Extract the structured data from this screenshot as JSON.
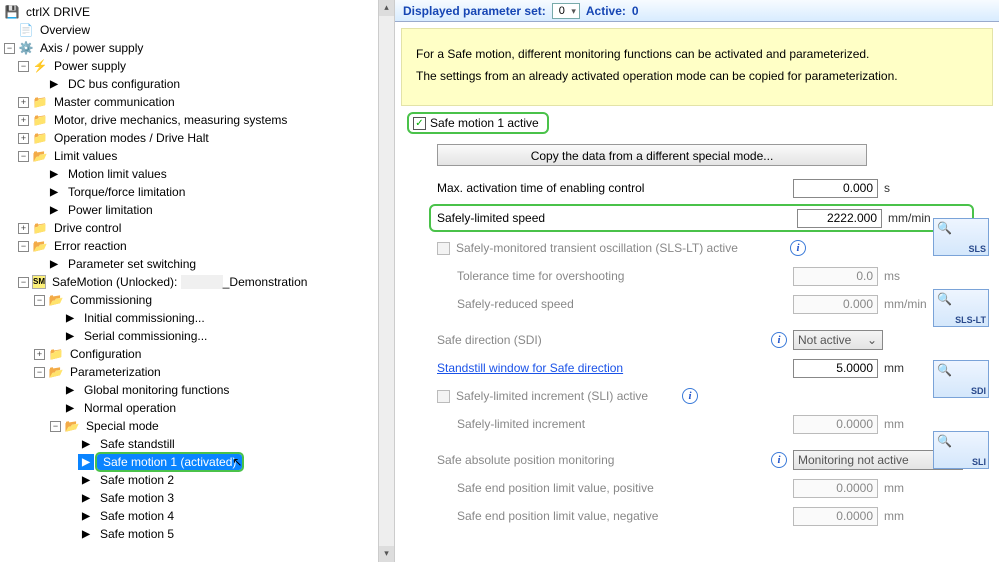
{
  "tree": {
    "root_label": "ctrlX DRIVE",
    "overview": "Overview",
    "axis": "Axis / power supply",
    "power_supply": "Power supply",
    "dc_bus": "DC bus configuration",
    "master_comm": "Master communication",
    "motor": "Motor, drive mechanics, measuring systems",
    "op_modes": "Operation modes / Drive Halt",
    "limit_values": "Limit values",
    "motion_limit": "Motion limit values",
    "torque": "Torque/force limitation",
    "power_lim": "Power limitation",
    "drive_ctrl": "Drive control",
    "error_react": "Error reaction",
    "param_switch": "Parameter set switching",
    "safemotion": "SafeMotion (Unlocked): ",
    "safemotion_suffix": "_Demonstration",
    "commissioning": "Commissioning",
    "init_comm": "Initial commissioning...",
    "serial_comm": "Serial commissioning...",
    "configuration": "Configuration",
    "parameterization": "Parameterization",
    "global_mon": "Global monitoring functions",
    "normal_op": "Normal operation",
    "special_mode": "Special mode",
    "safe_standstill": "Safe standstill",
    "safe_motion_1": "Safe motion 1 (activated)",
    "safe_motion_2": "Safe motion 2",
    "safe_motion_3": "Safe motion 3",
    "safe_motion_4": "Safe motion 4",
    "safe_motion_5": "Safe motion 5"
  },
  "bar": {
    "label1": "Displayed parameter set:",
    "val1": "0",
    "label2": "Active:",
    "val2": "0"
  },
  "banner": {
    "line1": "For a Safe motion, different monitoring functions can be activated and parameterized.",
    "line2": "The settings from an already activated operation mode can be copied for parameterization."
  },
  "form": {
    "chk_active": "Safe motion 1 active",
    "copy_btn": "Copy the data from a different special mode...",
    "r_max_act": "Max. activation time of enabling control",
    "r_max_act_val": "0.000",
    "r_max_act_unit": "s",
    "r_sls": "Safely-limited speed",
    "r_sls_val": "2222.000",
    "r_sls_unit": "mm/min",
    "r_sls_lt": "Safely-monitored transient oscillation (SLS-LT) active",
    "r_tol": "Tolerance time for overshooting",
    "r_tol_val": "0.0",
    "r_tol_unit": "ms",
    "r_srs": "Safely-reduced speed",
    "r_srs_val": "0.000",
    "r_srs_unit": "mm/min",
    "r_sdi": "Safe direction (SDI)",
    "r_sdi_val": "Not active",
    "r_stw": "Standstill window for Safe direction",
    "r_stw_val": "5.0000",
    "r_stw_unit": "mm",
    "r_sli": "Safely-limited increment (SLI) active",
    "r_sli_inc": "Safely-limited increment",
    "r_sli_inc_val": "0.0000",
    "r_sli_inc_unit": "mm",
    "r_sap": "Safe absolute position monitoring",
    "r_sap_val": "Monitoring not active",
    "r_sap_pos": "Safe end position limit value, positive",
    "r_sap_pos_val": "0.0000",
    "r_sap_pos_unit": "mm",
    "r_sap_neg": "Safe end position limit value, negative",
    "r_sap_neg_val": "0.0000",
    "r_sap_neg_unit": "mm"
  },
  "thumbs": {
    "sls": "SLS",
    "sls_lt": "SLS-LT",
    "sdi": "SDI",
    "sli": "SLI"
  }
}
